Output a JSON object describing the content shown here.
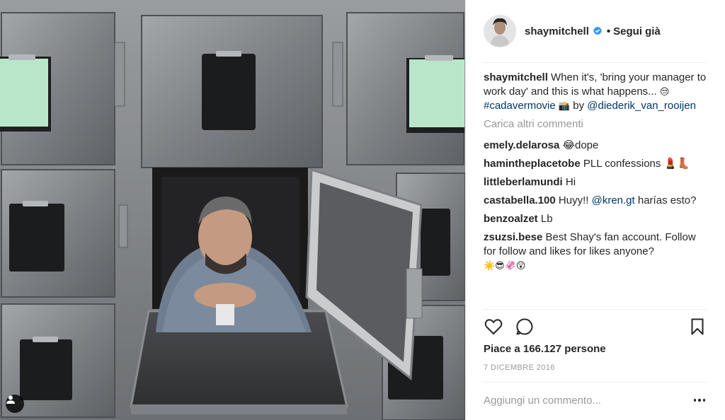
{
  "post": {
    "author": "shaymitchell",
    "follow_separator": "•",
    "follow_label": "Segui già",
    "caption": {
      "author": "shaymitchell",
      "text_1": "When it's, 'bring your manager to work day' and this is what happens...",
      "emoji_1": "😒",
      "hashtag": "#cadavermovie",
      "emoji_2": "📸",
      "text_2": "by",
      "mention": "@diederik_van_rooijen"
    },
    "load_more": "Carica altri commenti",
    "comments": [
      {
        "user": "emely.delarosa",
        "text": "😂dope"
      },
      {
        "user": "haminthe placetobe",
        "text": "PLL confessions 💄👢"
      },
      {
        "user": "littleberlamundi",
        "text": "Hi"
      },
      {
        "user": "castabella.100",
        "text_before": "Huyy!!",
        "mention": "@kren.gt",
        "text_after": "harías esto?"
      },
      {
        "user": "benzoalzet",
        "text": "Lb"
      },
      {
        "user": "zsuzsi.bese",
        "text": "Best Shay's fan account. Follow for follow and likes for likes anyone?",
        "emoji": "☀️😎🦑😲"
      }
    ],
    "likes": "Piace a 166.127 persone",
    "date": "7 DICEMBRE 2016",
    "add_comment_placeholder": "Aggiungi un commento...",
    "icons": {
      "like": "heart-icon",
      "comment": "speech-bubble-icon",
      "save": "bookmark-icon",
      "more": "ellipsis-icon",
      "verified": "verified-badge-icon",
      "tag": "user-tag-icon"
    },
    "colors": {
      "link": "#003569",
      "verified": "#3897f0",
      "muted": "#999999"
    }
  }
}
